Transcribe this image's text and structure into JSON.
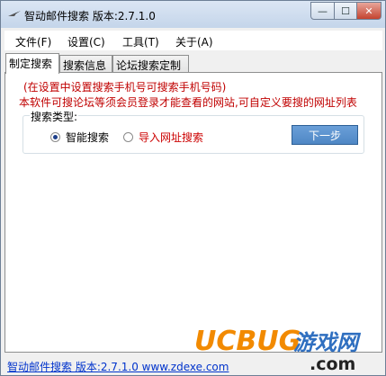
{
  "window": {
    "title": "智动邮件搜索 版本:2.7.1.0",
    "minimize_glyph": "—",
    "maximize_glyph": "☐",
    "close_glyph": "✕",
    "icon": "app-icon"
  },
  "menu": {
    "items": [
      {
        "label": "文件(F)"
      },
      {
        "label": "设置(C)"
      },
      {
        "label": "工具(T)"
      },
      {
        "label": "关于(A)"
      }
    ]
  },
  "tabs": [
    {
      "label": "制定搜索",
      "active": true
    },
    {
      "label": "搜索信息",
      "active": false
    },
    {
      "label": "论坛搜索定制",
      "active": false
    }
  ],
  "panel": {
    "hint": "(在设置中设置搜索手机号可搜索手机号码)",
    "description": "本软件可搜论坛等须会员登录才能查看的网站,可自定义要搜的网址列表",
    "group_label": "搜索类型:",
    "radios": [
      {
        "label": "智能搜索",
        "checked": true,
        "color": "#000000"
      },
      {
        "label": "导入网址搜索",
        "checked": false,
        "color": "#cc0000"
      }
    ],
    "next_button": "下一步"
  },
  "watermark": {
    "brand": "UCBUG",
    "suffix": "游戏网",
    "domain": ".com"
  },
  "status": {
    "link_text": "智动邮件搜索 版本:2.7.1.0 www.zdexe.com"
  },
  "colors": {
    "accent_blue": "#4f87c5",
    "hint_red": "#c00000",
    "link_blue": "#0033cc",
    "watermark_orange": "#f28a00",
    "watermark_blue": "#2f6fc0"
  }
}
